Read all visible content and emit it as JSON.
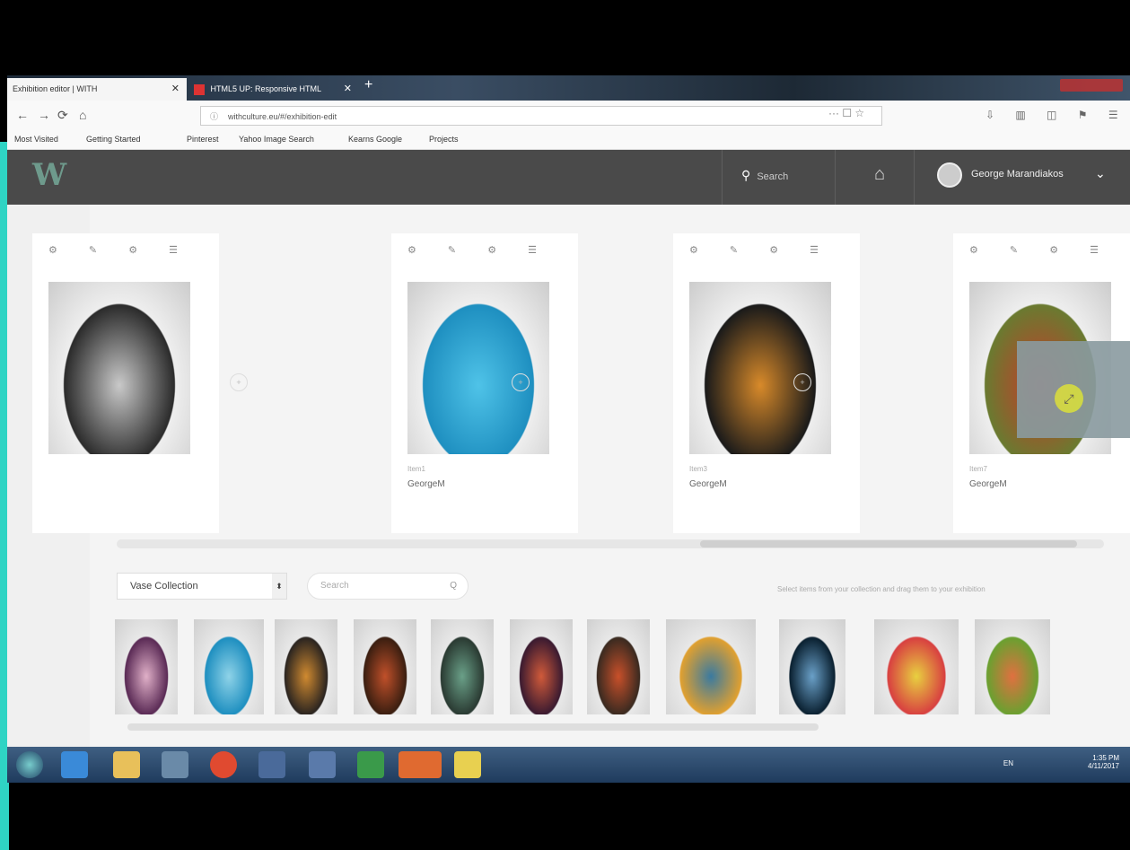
{
  "browser": {
    "tabs": [
      {
        "label": "Exhibition editor | WITH",
        "close": "✕"
      },
      {
        "label": "HTML5 UP: Responsive HTML",
        "close": "✕"
      }
    ],
    "new_tab": "+",
    "url": "withculture.eu/#/exhibition-edit",
    "nav": {
      "back": "←",
      "forward": "→",
      "reload": "⟳",
      "home": "⌂"
    },
    "url_icons": "··· ☐ ☆",
    "tool_icons": "⇩ ▥ ◫ ⚑ ☰",
    "bookmarks": [
      "Most Visited",
      "Getting Started",
      "Pinterest",
      "Yahoo Image Search",
      "Kearns Google",
      "Projects"
    ]
  },
  "app": {
    "logo": "W",
    "search_label": "Search",
    "search_icon": "search-icon",
    "user_name": "George Marandiakos",
    "user_chevron": "⌄"
  },
  "cards": [
    {
      "label": "",
      "name": "",
      "colors": [
        "#2b2b2b",
        "#c9c9c9"
      ]
    },
    {
      "label": "Item1",
      "name": "GeorgeM",
      "colors": [
        "#1e8fc0",
        "#4fc3e8"
      ]
    },
    {
      "label": "Item3",
      "name": "GeorgeM",
      "colors": [
        "#1a1a1a",
        "#d88a2a"
      ]
    },
    {
      "label": "Item7",
      "name": "GeorgeM",
      "colors": [
        "#6a7a30",
        "#c83a2a"
      ]
    }
  ],
  "card_tools": "⚙ ✎ ⚙ ☰",
  "gap_icon": "+",
  "overlay_icon": "⤢",
  "collection": {
    "selected": "Vase Collection",
    "arrow": "⬍",
    "search_placeholder": "Search",
    "search_icon": "Q",
    "hint": "Select items from your collection and drag them to your exhibition"
  },
  "thumbnails": [
    {
      "c1": "#5a2a55",
      "c2": "#e0b0c8"
    },
    {
      "c1": "#1e8fc0",
      "c2": "#8fd3e8"
    },
    {
      "c1": "#2a2420",
      "c2": "#d08a30"
    },
    {
      "c1": "#3a1e10",
      "c2": "#c0502a"
    },
    {
      "c1": "#2a3a32",
      "c2": "#6aa088"
    },
    {
      "c1": "#3a1a30",
      "c2": "#d05a3a"
    },
    {
      "c1": "#3a2a20",
      "c2": "#c8502a"
    },
    {
      "c1": "#e0a030",
      "c2": "#3a7aa0"
    },
    {
      "c1": "#0a2030",
      "c2": "#6aa0c8"
    },
    {
      "c1": "#d84040",
      "c2": "#e8d040"
    },
    {
      "c1": "#6aa030",
      "c2": "#e07040"
    }
  ],
  "taskbar": {
    "time": "1:35 PM",
    "date": "4/11/2017",
    "lang": "EN"
  }
}
